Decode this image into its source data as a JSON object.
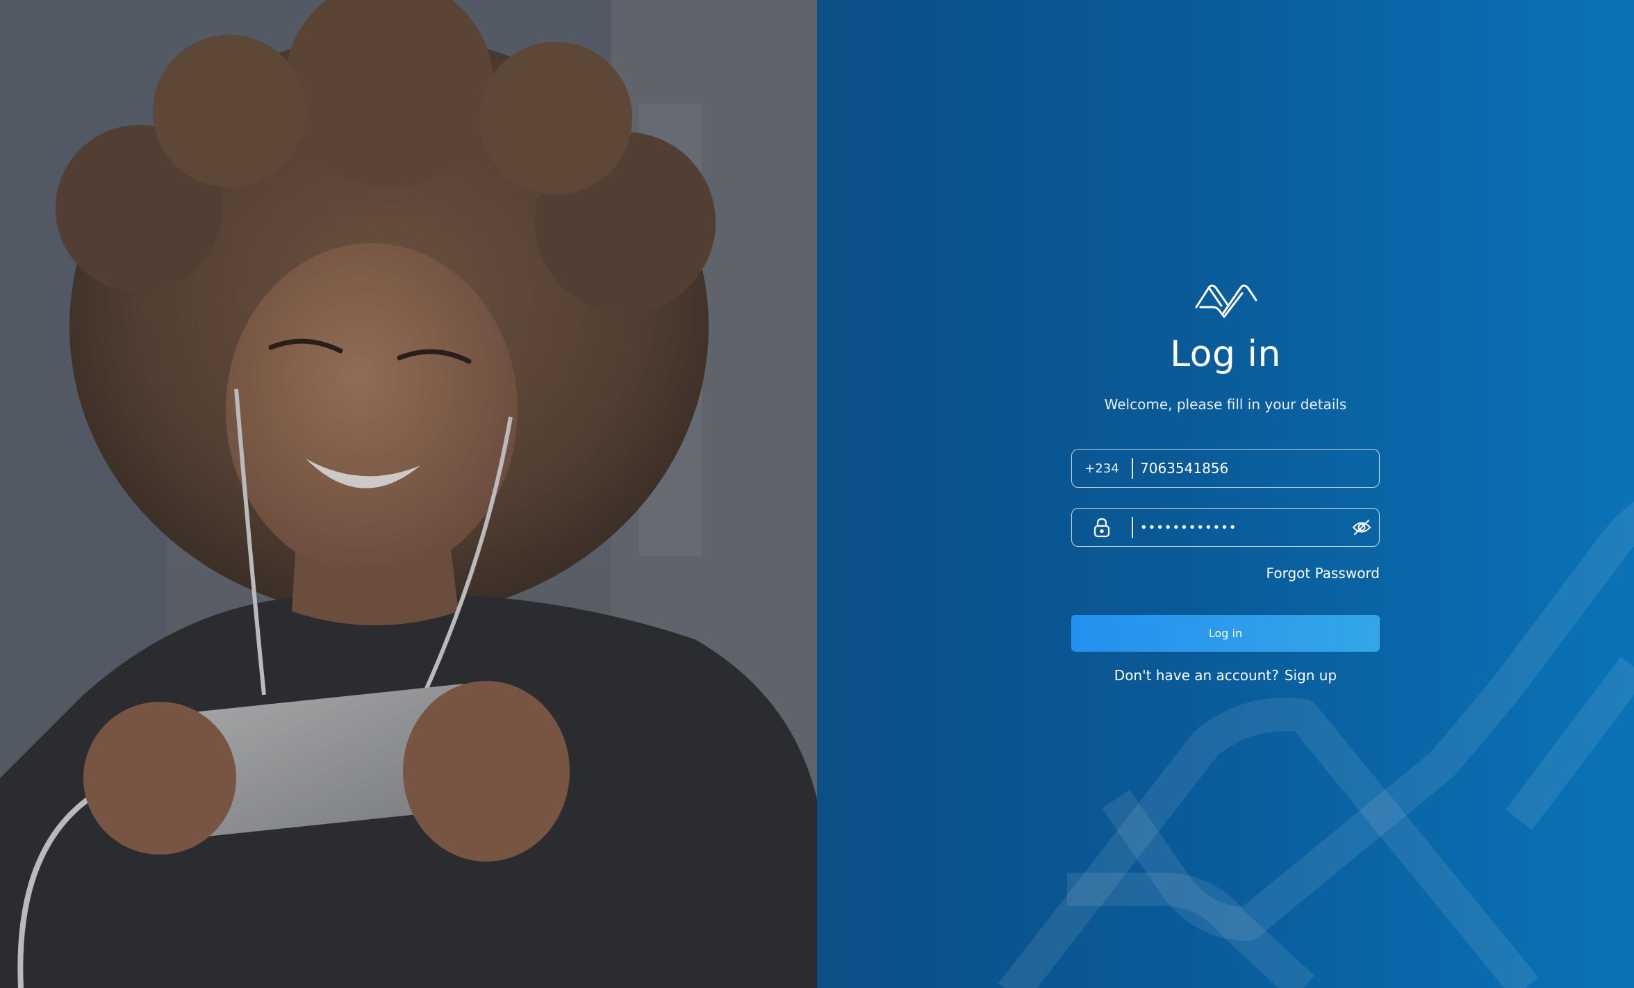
{
  "login": {
    "title": "Log in",
    "subtitle": "Welcome, please fill in your details",
    "phone": {
      "country_code": "+234",
      "value": "7063541856"
    },
    "password": {
      "masked_value": "••••••••••••"
    },
    "forgot_password_label": "Forgot Password",
    "submit_label": "Log in",
    "signup_prompt": "Don't have an account?",
    "signup_label": "Sign up"
  },
  "icons": {
    "logo": "brand-logo-icon",
    "lock": "lock-icon",
    "eye": "eye-slash-icon"
  },
  "colors": {
    "panel_start": "#0b4f86",
    "panel_end": "#0a73b6",
    "button_start": "#2490f0",
    "button_end": "#34a6e8",
    "text": "#ffffff"
  }
}
